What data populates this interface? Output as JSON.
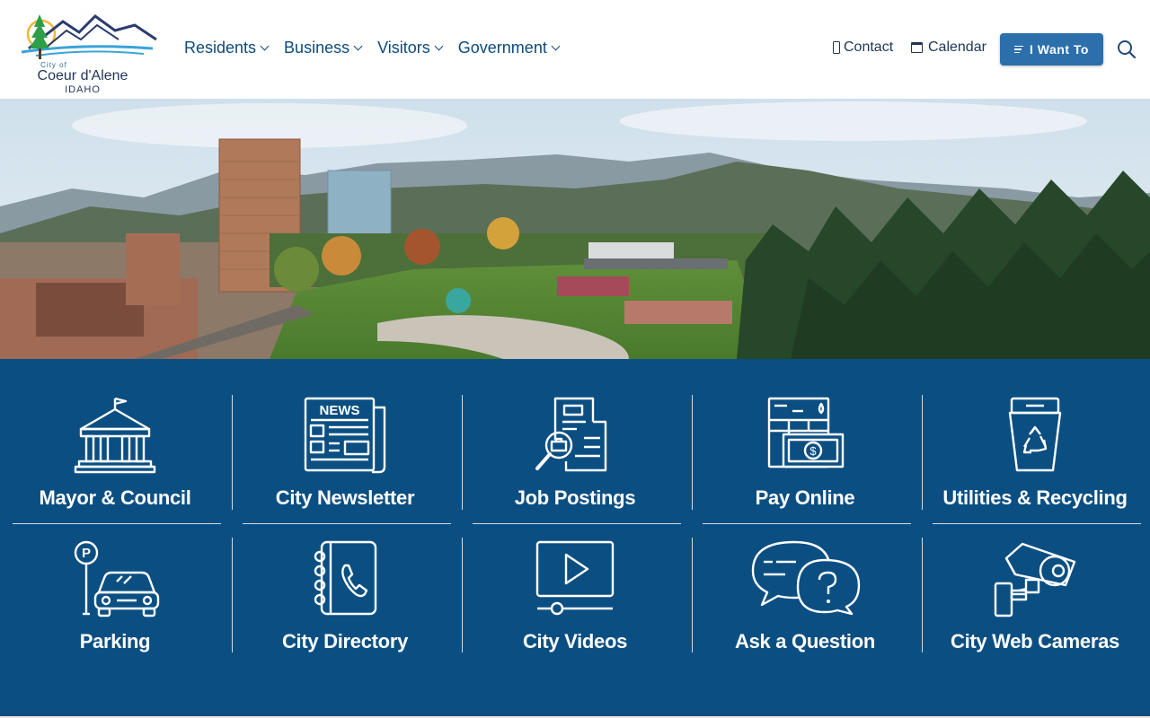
{
  "logo": {
    "city_of": "City of",
    "name": "Coeur d'Alene",
    "state": "IDAHO"
  },
  "nav": {
    "items": [
      {
        "label": "Residents"
      },
      {
        "label": "Business"
      },
      {
        "label": "Visitors"
      },
      {
        "label": "Government"
      }
    ]
  },
  "utility": {
    "contact_label": "Contact",
    "calendar_label": "Calendar",
    "want_label": "I Want To"
  },
  "tiles": [
    {
      "label": "Mayor & Council",
      "icon": "city-hall-icon"
    },
    {
      "label": "City Newsletter",
      "icon": "newspaper-icon"
    },
    {
      "label": "Job Postings",
      "icon": "job-search-icon"
    },
    {
      "label": "Pay Online",
      "icon": "bill-payment-icon"
    },
    {
      "label": "Utilities & Recycling",
      "icon": "recycling-bin-icon"
    },
    {
      "label": "Parking",
      "icon": "parking-icon"
    },
    {
      "label": "City Directory",
      "icon": "phone-book-icon"
    },
    {
      "label": "City Videos",
      "icon": "video-play-icon"
    },
    {
      "label": "Ask a Question",
      "icon": "question-bubble-icon"
    },
    {
      "label": "City Web Cameras",
      "icon": "security-camera-icon"
    }
  ],
  "colors": {
    "brand_blue": "#0b4f82",
    "button_blue": "#2d6fab",
    "nav_text": "#0e4a7a"
  }
}
